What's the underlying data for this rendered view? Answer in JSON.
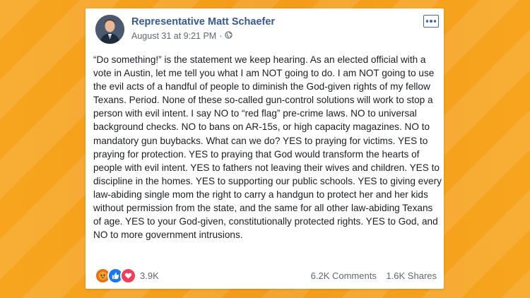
{
  "post": {
    "author": "Representative Matt Schaefer",
    "timestamp": "August 31 at 9:21 PM",
    "separator": "·",
    "text": "“Do something!” is the statement we keep hearing. As an elected official with a vote in Austin, let me tell you what I am NOT going to do. I am NOT going to use the evil acts of a handful of people to diminish the God-given rights of my fellow Texans. Period. None of these so-called gun-control solutions will work to stop a person with evil intent. I say NO to “red flag” pre-crime laws. NO to universal background checks. NO to bans on AR-15s, or high capacity magazines. NO to mandatory gun buybacks. What can we do? YES to praying for victims. YES to praying for protection. YES to praying that God would transform the hearts of people with evil intent. YES to fathers not leaving their wives and children. YES to discipline in the homes. YES to supporting our public schools. YES to giving every law-abiding single mom the right to carry a handgun to protect her and her kids without permission from the state, and the same for all other law-abiding Texans of age. YES to your God-given, constitutionally protected rights. YES to God, and NO to more government intrusions."
  },
  "footer": {
    "reaction_icons": [
      "angry-icon",
      "like-icon",
      "love-icon"
    ],
    "reaction_count": "3.9K",
    "comments": "6.2K Comments",
    "shares": "1.6K Shares"
  },
  "colors": {
    "background": "#f5a21f",
    "author_link": "#385898",
    "like": "#1877f2",
    "love": "#f33e58",
    "angry": "#e9710f"
  }
}
